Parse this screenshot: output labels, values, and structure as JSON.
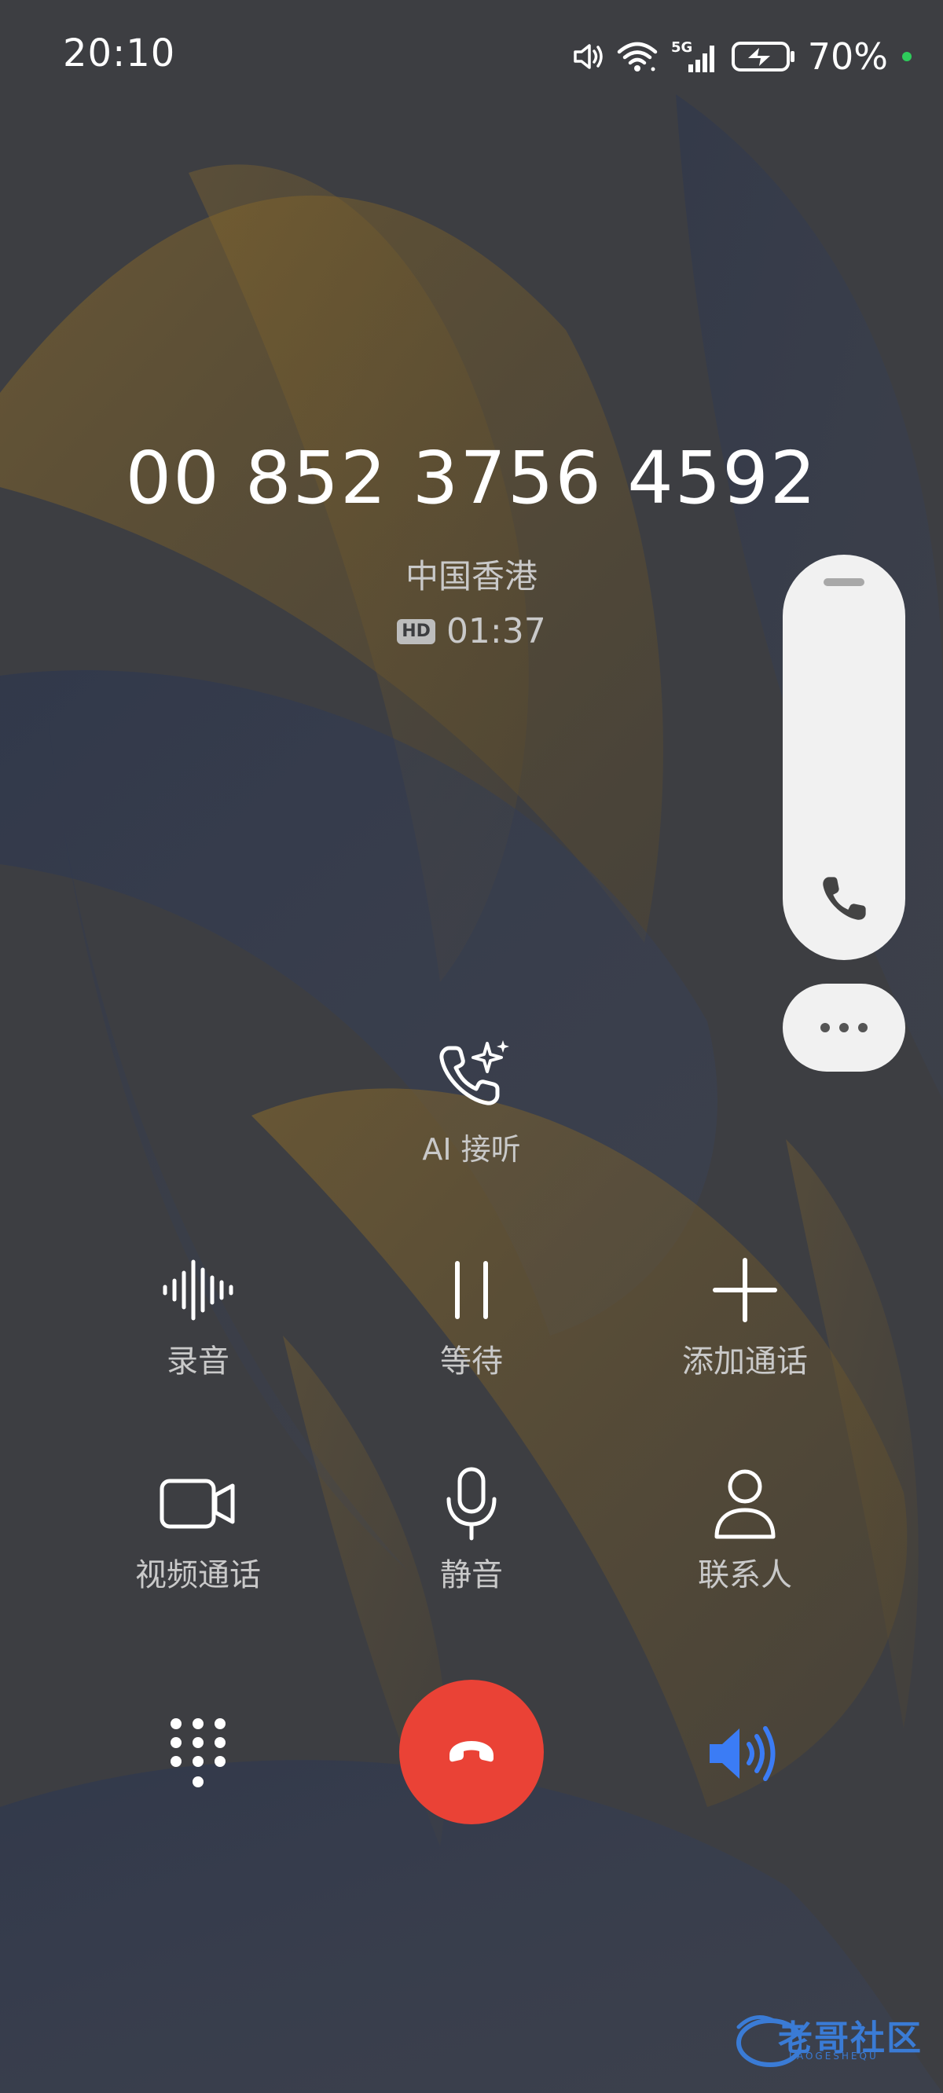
{
  "status_bar": {
    "time": "20:10",
    "network": "5G",
    "battery": "70%"
  },
  "call": {
    "number": "00 852 3756 4592",
    "location": "中国香港",
    "hd_badge": "HD",
    "duration": "01:37"
  },
  "ai_answer": {
    "label": "AI 接听"
  },
  "controls": {
    "record": "录音",
    "hold": "等待",
    "add_call": "添加通话",
    "video_call": "视频通话",
    "mute": "静音",
    "contacts": "联系人"
  },
  "speaker_active": true,
  "colors": {
    "end_call": "#ea4236",
    "speaker_active": "#3b7cf5",
    "background": "#3c3d40"
  },
  "watermark": {
    "text": "老哥社区",
    "sub": "LAOGESHEQU"
  }
}
